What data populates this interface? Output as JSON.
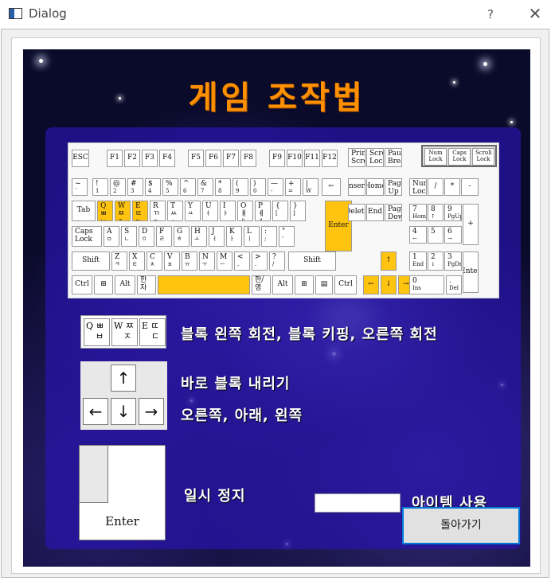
{
  "window": {
    "title": "Dialog",
    "help": "?",
    "close": "✕"
  },
  "game": {
    "title": "게임 조작법"
  },
  "keyboard": {
    "esc": "ESC",
    "f": [
      "F1",
      "F2",
      "F3",
      "F4",
      "F5",
      "F6",
      "F7",
      "F8",
      "F9",
      "F10",
      "F11",
      "F12"
    ],
    "print": "Print Screen",
    "scroll": "Scroll Lock",
    "pause": "Pause Break",
    "locks": [
      "Num Lock",
      "Caps Lock",
      "Scroll Lock"
    ],
    "num_row": [
      [
        "~",
        "`"
      ],
      [
        "!",
        "1"
      ],
      [
        "@",
        "2"
      ],
      [
        "#",
        "3"
      ],
      [
        "$",
        "4"
      ],
      [
        "%",
        "5"
      ],
      [
        "^",
        "6"
      ],
      [
        "&",
        "7"
      ],
      [
        "*",
        "8"
      ],
      [
        "(",
        "9"
      ],
      [
        ")",
        "0"
      ],
      [
        "—",
        "-"
      ],
      [
        "+",
        "="
      ],
      [
        "|",
        "W"
      ]
    ],
    "backspace": "←",
    "insert": "Insert",
    "home": "Home",
    "pageup": "Page Up",
    "delete": "Delete",
    "end": "End",
    "pagedown": "Page Down",
    "numlock": "Num Lock",
    "np_div": "/",
    "np_mul": "*",
    "np_sub": "-",
    "tab": "Tab",
    "q_row": [
      [
        "Q",
        "ㅂ",
        "ㅃ"
      ],
      [
        "W",
        "ㅈ",
        "ㅉ"
      ],
      [
        "E",
        "ㄷ",
        "ㄸ"
      ],
      [
        "R",
        "ㄱ",
        "ㄲ"
      ],
      [
        "T",
        "ㅅ",
        "ㅆ"
      ],
      [
        "Y",
        "ㅛ",
        ""
      ],
      [
        "U",
        "ㅕ",
        ""
      ],
      [
        "I",
        "ㅑ",
        ""
      ],
      [
        "O",
        "ㅐ",
        "ㅒ"
      ],
      [
        "P",
        "ㅔ",
        "ㅖ"
      ],
      [
        "{",
        "[",
        ""
      ],
      [
        "}",
        "]",
        ""
      ]
    ],
    "caps": "Caps Lock",
    "a_row": [
      [
        "A",
        "ㅁ"
      ],
      [
        "S",
        "ㄴ"
      ],
      [
        "D",
        "ㅇ"
      ],
      [
        "F",
        "ㄹ"
      ],
      [
        "G",
        "ㅎ"
      ],
      [
        "H",
        "ㅗ"
      ],
      [
        "J",
        "ㅓ"
      ],
      [
        "K",
        "ㅏ"
      ],
      [
        "L",
        "ㅣ"
      ],
      [
        ":",
        ";"
      ],
      [
        "\"",
        "'"
      ]
    ],
    "enter": "Enter",
    "shift": "Shift",
    "z_row": [
      [
        "Z",
        "ㅋ"
      ],
      [
        "X",
        "ㅌ"
      ],
      [
        "C",
        "ㅊ"
      ],
      [
        "V",
        "ㅍ"
      ],
      [
        "B",
        "ㅠ"
      ],
      [
        "N",
        "ㅜ"
      ],
      [
        "M",
        "ㅡ"
      ],
      [
        "<",
        ","
      ],
      [
        ">",
        "."
      ],
      [
        "?",
        "/"
      ]
    ],
    "ctrl": "Ctrl",
    "alt": "Alt",
    "hanja": "한자",
    "hanyeong": "한/영",
    "up": "↑",
    "left": "←",
    "down": "↓",
    "right": "→",
    "np7": [
      "7",
      "Home"
    ],
    "np8": [
      "8",
      "↑"
    ],
    "np9": [
      "9",
      "PgUp"
    ],
    "np_add": "+",
    "np4": [
      "4",
      "←"
    ],
    "np5": [
      "5",
      ""
    ],
    "np6": [
      "6",
      "→"
    ],
    "np1": [
      "1",
      "End"
    ],
    "np2": [
      "2",
      "↓"
    ],
    "np3": [
      "3",
      "PgDn"
    ],
    "np_enter": "Enter",
    "np0": [
      "0",
      "Ins"
    ],
    "np_dot": [
      ".",
      "Del"
    ]
  },
  "legend": {
    "qwe_keys": [
      [
        "Q",
        "ㅂ",
        "ㅃ"
      ],
      [
        "W",
        "ㅈ",
        "ㅉ"
      ],
      [
        "E",
        "ㄷ",
        "ㄸ"
      ]
    ],
    "qwe_desc": "블록 왼쪽 회전, 블록 키핑, 오른쪽 회전",
    "arrows": {
      "up": "↑",
      "left": "←",
      "down": "↓",
      "right": "→"
    },
    "up_desc": "바로 블록 내리기",
    "lrd_desc": "오른쪽, 아래, 왼쪽",
    "enter_label": "Enter",
    "enter_desc": "일시 정지",
    "item_desc": "아이템 사용",
    "item_value": ""
  },
  "buttons": {
    "back": "돌아가기"
  }
}
